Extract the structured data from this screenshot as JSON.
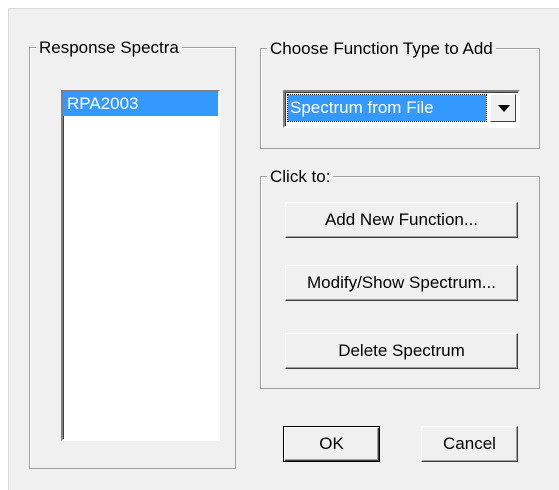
{
  "groups": {
    "response_spectra": "Response Spectra",
    "choose_function_type": "Choose  Function Type to Add",
    "click_to": "Click to:"
  },
  "spectra_list": {
    "items": [
      {
        "label": "RPA2003",
        "selected": true
      }
    ]
  },
  "function_type": {
    "selected": "Spectrum from File",
    "icon": "chevron-down-icon"
  },
  "actions": {
    "add_new": "Add New Function...",
    "modify_show": "Modify/Show Spectrum...",
    "delete": "Delete Spectrum"
  },
  "footer": {
    "ok": "OK",
    "cancel": "Cancel"
  },
  "colors": {
    "selection": "#3399ff",
    "face": "#f0f0f0"
  }
}
